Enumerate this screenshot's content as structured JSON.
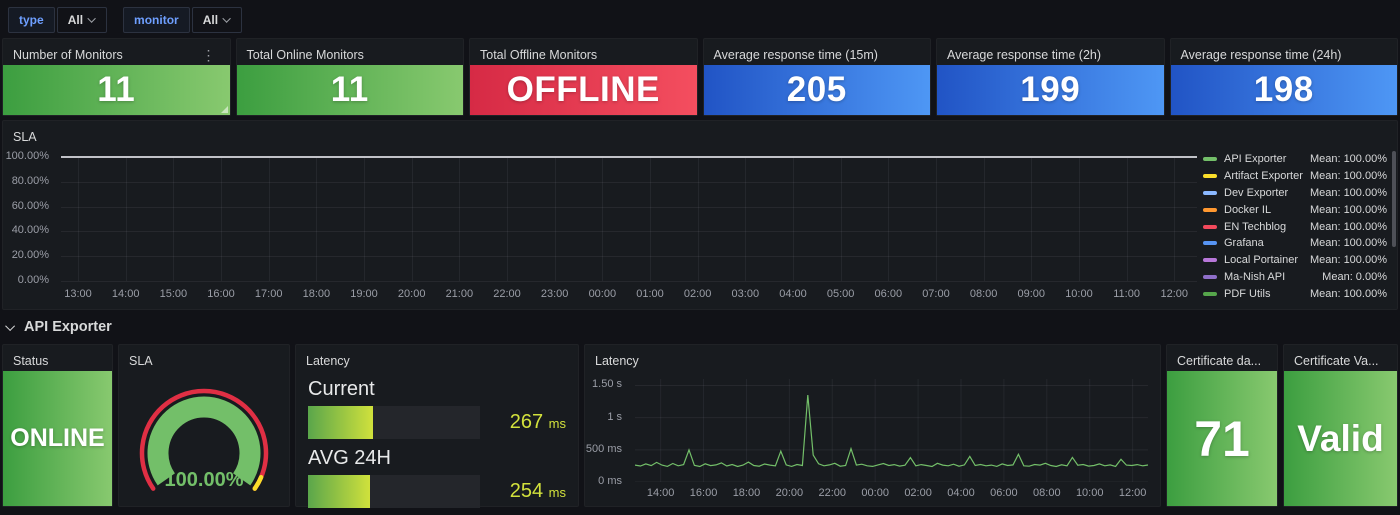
{
  "filters": {
    "groups": [
      {
        "label": "type",
        "value": "All"
      },
      {
        "label": "monitor",
        "value": "All"
      }
    ]
  },
  "palette": {
    "green_grad": [
      "#3c9e40",
      "#88c96f"
    ],
    "red_grad": [
      "#d62a45",
      "#f44e5f"
    ],
    "blue_grad": [
      "#2154c5",
      "#4e97f5"
    ],
    "bar_grad": [
      "#5aa64b",
      "#d0e13c"
    ],
    "bar_value_text": "#d2e13c",
    "series_line": "#73BF69",
    "flat_line": "#c0c2c7",
    "gauge_ring": "#e02f44",
    "gauge_ring_segment": "#FADE2A",
    "gauge_bar": "#73BF69",
    "gauge_text": "#73BF69"
  },
  "stats": [
    {
      "title": "Number of Monitors",
      "value": "11",
      "color": "green_grad",
      "has_menu": true
    },
    {
      "title": "Total Online Monitors",
      "value": "11",
      "color": "green_grad",
      "has_menu": false
    },
    {
      "title": "Total Offline Monitors",
      "value": "OFFLINE",
      "color": "red_grad",
      "has_menu": false
    },
    {
      "title": "Average response time (15m)",
      "value": "205",
      "color": "blue_grad",
      "has_menu": false
    },
    {
      "title": "Average response time (2h)",
      "value": "199",
      "color": "blue_grad",
      "has_menu": false
    },
    {
      "title": "Average response time (24h)",
      "value": "198",
      "color": "blue_grad",
      "has_menu": false
    }
  ],
  "section_row": {
    "title": "API Exporter"
  },
  "api_exporter": {
    "status": {
      "title": "Status",
      "value": "ONLINE"
    },
    "certificate_days": {
      "title": "Certificate da...",
      "value": "71"
    },
    "certificate_validity": {
      "title": "Certificate Va...",
      "value": "Valid"
    }
  },
  "chart_data": [
    {
      "type": "line",
      "title": "SLA",
      "ylim": [
        0,
        100
      ],
      "yticks": [
        "0.00%",
        "20.00%",
        "40.00%",
        "60.00%",
        "80.00%",
        "100.00%"
      ],
      "ytick_values": [
        0,
        20,
        40,
        60,
        80,
        100
      ],
      "xticks": [
        "13:00",
        "14:00",
        "15:00",
        "16:00",
        "17:00",
        "18:00",
        "19:00",
        "20:00",
        "21:00",
        "22:00",
        "23:00",
        "00:00",
        "01:00",
        "02:00",
        "03:00",
        "04:00",
        "05:00",
        "06:00",
        "07:00",
        "08:00",
        "09:00",
        "10:00",
        "11:00",
        "12:00"
      ],
      "grid": true,
      "legend_position": "right",
      "series": [
        {
          "name": "API Exporter",
          "color": "#73BF69",
          "mean_label": "Mean: 100.00%",
          "value_pct": 100
        },
        {
          "name": "Artifact Exporter",
          "color": "#FADE2A",
          "mean_label": "Mean: 100.00%",
          "value_pct": 100
        },
        {
          "name": "Dev Exporter",
          "color": "#8AB8FF",
          "mean_label": "Mean: 100.00%",
          "value_pct": 100
        },
        {
          "name": "Docker IL",
          "color": "#FF9830",
          "mean_label": "Mean: 100.00%",
          "value_pct": 100
        },
        {
          "name": "EN Techblog",
          "color": "#F2495C",
          "mean_label": "Mean: 100.00%",
          "value_pct": 100
        },
        {
          "name": "Grafana",
          "color": "#5794F2",
          "mean_label": "Mean: 100.00%",
          "value_pct": 100
        },
        {
          "name": "Local Portainer",
          "color": "#B877D9",
          "mean_label": "Mean: 100.00%",
          "value_pct": 100
        },
        {
          "name": "Ma-Nish API",
          "color": "#8F6FC9",
          "mean_label": "Mean: 0.00%",
          "value_pct": 0
        },
        {
          "name": "PDF Utils",
          "color": "#56A64B",
          "mean_label": "Mean: 100.00%",
          "value_pct": 100
        }
      ]
    },
    {
      "type": "line",
      "title": "Latency",
      "ylim": [
        0,
        1600
      ],
      "yticks": [
        "0 ms",
        "500 ms",
        "1 s",
        "1.50 s"
      ],
      "ytick_values": [
        0,
        500,
        1000,
        1500
      ],
      "xticks": [
        "14:00",
        "16:00",
        "18:00",
        "20:00",
        "22:00",
        "00:00",
        "02:00",
        "04:00",
        "06:00",
        "08:00",
        "10:00",
        "12:00"
      ],
      "grid": true,
      "values_ms": [
        262,
        248,
        281,
        255,
        304,
        263,
        242,
        288,
        252,
        271,
        498,
        258,
        240,
        283,
        254,
        266,
        296,
        249,
        272,
        241,
        263,
        309,
        256,
        246,
        280,
        262,
        251,
        478,
        266,
        242,
        272,
        256,
        1352,
        418,
        282,
        252,
        265,
        291,
        246,
        257,
        517,
        262,
        276,
        251,
        242,
        266,
        287,
        256,
        271,
        247,
        261,
        379,
        252,
        271,
        256,
        241,
        291,
        262,
        251,
        277,
        246,
        266,
        398,
        257,
        272,
        251,
        262,
        242,
        281,
        257,
        266,
        431,
        252,
        246,
        272,
        262,
        291,
        256,
        241,
        267,
        251,
        382,
        261,
        272,
        247,
        257,
        281,
        252,
        266,
        242,
        352,
        262,
        256,
        271,
        251,
        264
      ]
    },
    {
      "type": "bar",
      "title": "Latency",
      "bars": [
        {
          "label": "Current",
          "value": "267",
          "unit": "ms",
          "fill_pct": 38
        },
        {
          "label": "AVG 24H",
          "value": "254",
          "unit": "ms",
          "fill_pct": 36
        }
      ]
    },
    {
      "type": "gauge",
      "title": "SLA",
      "value_label": "100.00%",
      "value_pct": 100
    }
  ]
}
